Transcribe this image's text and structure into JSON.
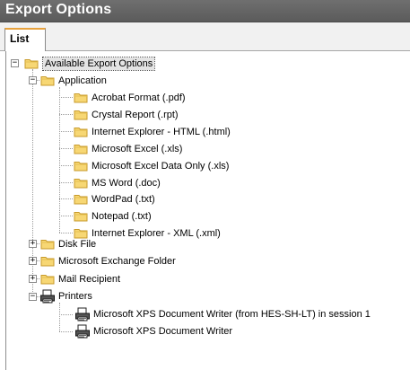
{
  "window": {
    "title": "Export Options"
  },
  "tabs": [
    {
      "label": "List"
    }
  ],
  "tree": {
    "root": "Available Export Options",
    "application": "Application",
    "app_items": [
      "Acrobat Format (.pdf)",
      "Crystal Report (.rpt)",
      "Internet Explorer - HTML (.html)",
      "Microsoft Excel (.xls)",
      "Microsoft Excel Data Only (.xls)",
      "MS Word (.doc)",
      "WordPad (.txt)",
      "Notepad (.txt)",
      "Internet Explorer - XML (.xml)"
    ],
    "disk_file": "Disk File",
    "exchange_folder": "Microsoft Exchange Folder",
    "mail_recipient": "Mail Recipient",
    "printers": "Printers",
    "printer_items": [
      "Microsoft XPS Document Writer (from HES-SH-LT) in session 1",
      "Microsoft XPS Document Writer"
    ],
    "expand_symbol": "+",
    "collapse_symbol": "−"
  },
  "colors": {
    "title_bg": "#5f5f5f",
    "tab_accent": "#e8a23c",
    "folder_fill": "#f7d774",
    "folder_edge": "#c79a2a"
  },
  "icons": {
    "folder": "folder-icon",
    "printer": "printer-icon"
  }
}
